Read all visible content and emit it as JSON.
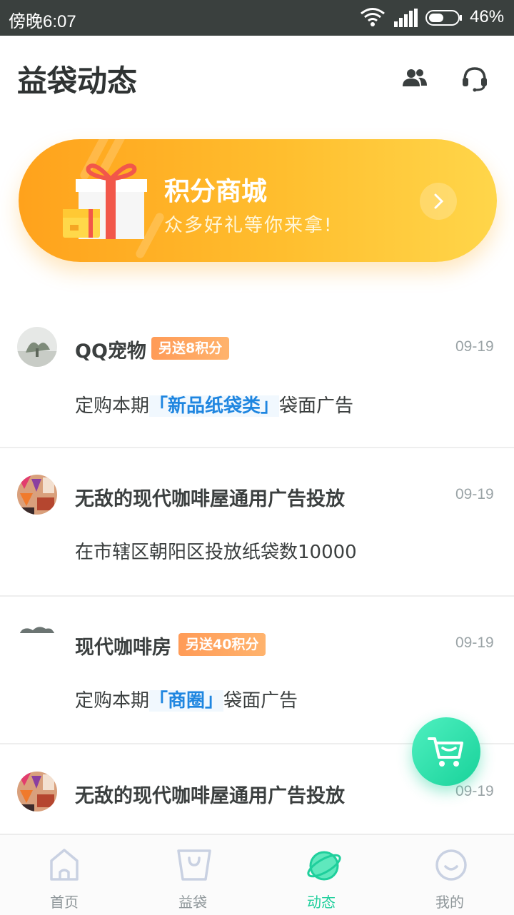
{
  "status_bar": {
    "time": "傍晚6:07",
    "battery": "46%"
  },
  "header": {
    "title": "益袋动态"
  },
  "banner": {
    "title": "积分商城",
    "subtitle": "众多好礼等你来拿!"
  },
  "feed": [
    {
      "name": "QQ宠物",
      "badge": "另送8积分",
      "date": "09-19",
      "desc_prefix": "定购本期",
      "desc_highlight": "「新品纸袋类」",
      "desc_suffix": "袋面广告"
    },
    {
      "name": "无敌的现代咖啡屋通用广告投放",
      "date": "09-19",
      "desc": "在市辖区朝阳区投放纸袋数10000"
    },
    {
      "name": "现代咖啡房",
      "badge": "另送40积分",
      "date": "09-19",
      "desc_prefix": "定购本期",
      "desc_highlight": "「商圈」",
      "desc_suffix": "袋面广告"
    },
    {
      "name": "无敌的现代咖啡屋通用广告投放",
      "date": "09-19"
    }
  ],
  "bottom_nav": [
    {
      "label": "首页",
      "icon": "home-icon"
    },
    {
      "label": "益袋",
      "icon": "bag-icon"
    },
    {
      "label": "动态",
      "icon": "planet-icon",
      "active": true
    },
    {
      "label": "我的",
      "icon": "face-icon"
    }
  ],
  "colors": {
    "accent": "#1fcf9c",
    "banner_start": "#ffa21c",
    "banner_end": "#ffd64a",
    "badge": "#ff9b57",
    "highlight_text": "#1f86e0"
  }
}
